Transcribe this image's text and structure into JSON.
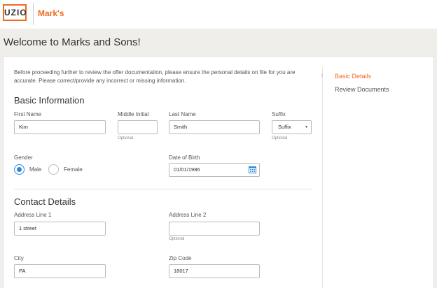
{
  "header": {
    "logo_text": "UZIO",
    "company": "Mark's"
  },
  "page_title": "Welcome to Marks and Sons!",
  "intro": "Before proceeding further to review the offer documentation, please ensure the personal details on file for you are accurate. Please correct/provide any incorrect or missing information.",
  "steps": [
    {
      "label": "Basic Details",
      "active": true
    },
    {
      "label": "Review Documents",
      "active": false
    }
  ],
  "basic": {
    "title": "Basic Information",
    "first_name": {
      "label": "First Name",
      "value": "Kim"
    },
    "middle_initial": {
      "label": "Middle Initial",
      "value": "",
      "hint": "Optional"
    },
    "last_name": {
      "label": "Last Name",
      "value": "Smith"
    },
    "suffix": {
      "label": "Suffix",
      "value": "Suffix",
      "hint": "Optional"
    },
    "gender": {
      "label": "Gender",
      "options": [
        "Male",
        "Female"
      ],
      "selected": "Male"
    },
    "dob": {
      "label": "Date of Birth",
      "value": "01/01/1986"
    }
  },
  "contact": {
    "title": "Contact Details",
    "address1": {
      "label": "Address Line 1",
      "value": "1 street"
    },
    "address2": {
      "label": "Address Line 2",
      "value": "",
      "hint": "Optional"
    },
    "city": {
      "label": "City",
      "value": "PA"
    },
    "zip": {
      "label": "Zip Code",
      "value": "18017"
    }
  },
  "colors": {
    "accent": "#f26b21",
    "radio": "#2b89d8"
  },
  "icons": {
    "dob_picker": "calendar-icon",
    "suffix_dropdown": "caret-down-icon",
    "step_pointer": "chevron-left-icon"
  }
}
